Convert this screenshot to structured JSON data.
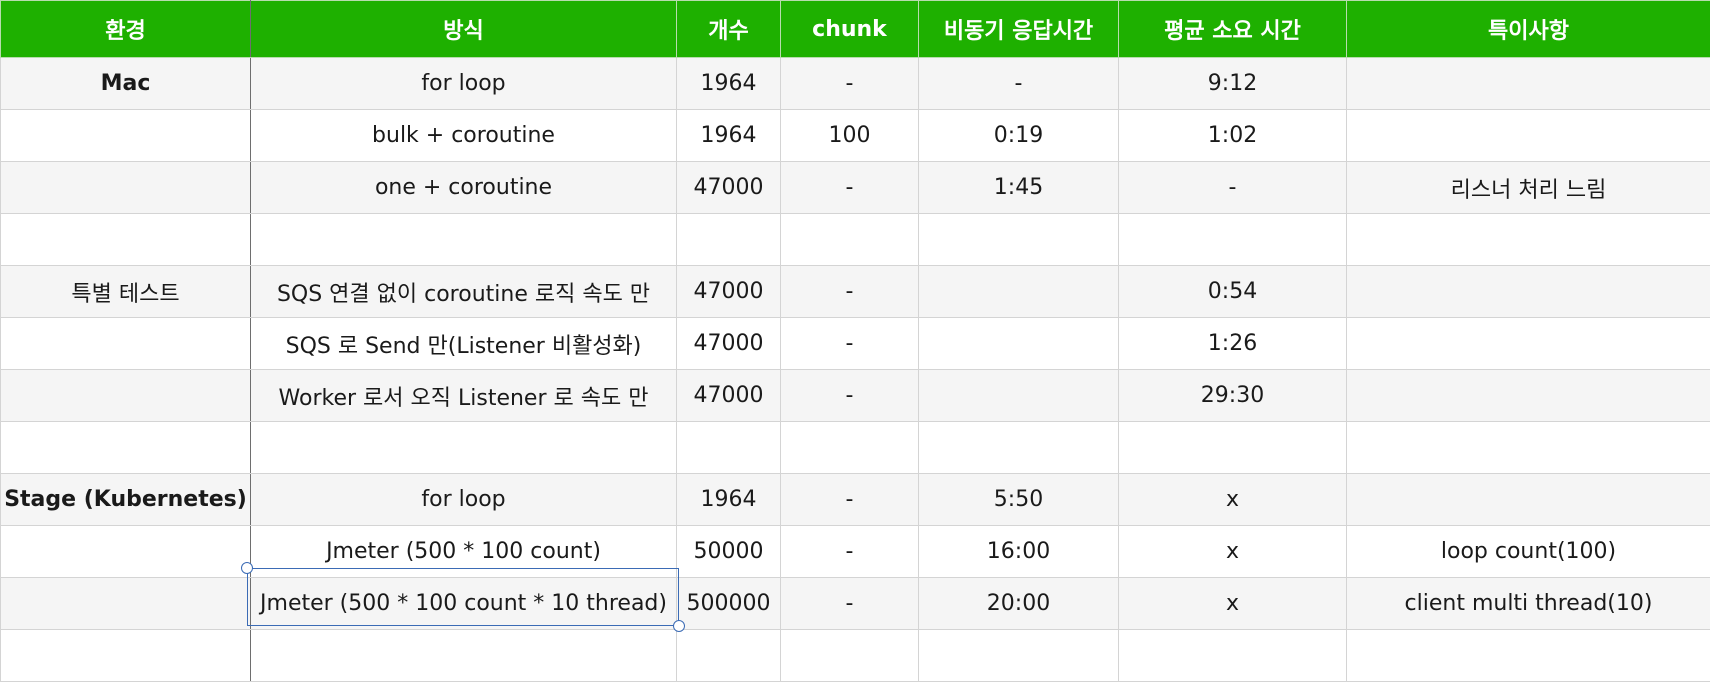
{
  "headers": [
    "환경",
    "방식",
    "개수",
    "chunk",
    "비동기 응답시간",
    "평균 소요 시간",
    "특이사항"
  ],
  "rows": [
    {
      "env": "Mac",
      "method": "for loop",
      "count": "1964",
      "chunk": "-",
      "async_response": "-",
      "avg_time": "9:12",
      "note": ""
    },
    {
      "env": "",
      "method": "bulk + coroutine",
      "count": "1964",
      "chunk": "100",
      "async_response": "0:19",
      "avg_time": "1:02",
      "note": ""
    },
    {
      "env": "",
      "method": "one + coroutine",
      "count": "47000",
      "chunk": "-",
      "async_response": "1:45",
      "avg_time": "-",
      "note": "리스너 처리 느림"
    },
    {
      "env": "",
      "method": "",
      "count": "",
      "chunk": "",
      "async_response": "",
      "avg_time": "",
      "note": ""
    },
    {
      "env": "특별 테스트",
      "method": "SQS 연결 없이 coroutine 로직 속도 만",
      "count": "47000",
      "chunk": "-",
      "async_response": "",
      "avg_time": "0:54",
      "note": ""
    },
    {
      "env": "",
      "method": "SQS 로 Send 만(Listener 비활성화)",
      "count": "47000",
      "chunk": "-",
      "async_response": "",
      "avg_time": "1:26",
      "note": ""
    },
    {
      "env": "",
      "method": "Worker 로서 오직 Listener 로 속도 만",
      "count": "47000",
      "chunk": "-",
      "async_response": "",
      "avg_time": "29:30",
      "note": ""
    },
    {
      "env": "",
      "method": "",
      "count": "",
      "chunk": "",
      "async_response": "",
      "avg_time": "",
      "note": ""
    },
    {
      "env": "Stage (Kubernetes)",
      "method": "for loop",
      "count": "1964",
      "chunk": "-",
      "async_response": "5:50",
      "avg_time": "x",
      "note": ""
    },
    {
      "env": "",
      "method": "Jmeter (500 * 100 count)",
      "count": "50000",
      "chunk": "-",
      "async_response": "16:00",
      "avg_time": "x",
      "note": "loop count(100)"
    },
    {
      "env": "",
      "method": "Jmeter (500 * 100 count * 10 thread)",
      "count": "500000",
      "chunk": "-",
      "async_response": "20:00",
      "avg_time": "x",
      "note": "client multi thread(10)"
    },
    {
      "env": "",
      "method": "",
      "count": "",
      "chunk": "",
      "async_response": "",
      "avg_time": "",
      "note": ""
    }
  ],
  "colors": {
    "header_bg": "#1eb000",
    "header_text": "#ffffff",
    "selection": "#3b6bb5"
  }
}
